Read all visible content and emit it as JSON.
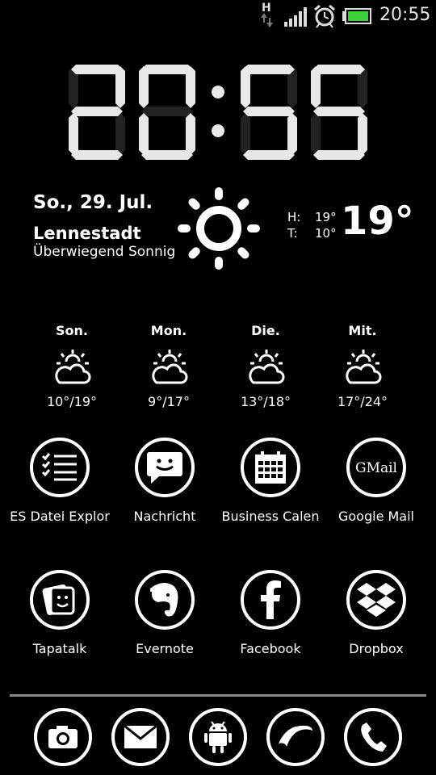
{
  "status_bar": {
    "network_type": "H",
    "time": "20:55",
    "icons": [
      "data-arrows-icon",
      "signal-icon",
      "alarm-icon",
      "battery-icon"
    ]
  },
  "clock": {
    "time": "20:55",
    "hours": "20",
    "minutes": "55"
  },
  "weather": {
    "date": "So., 29. Jul.",
    "city": "Lennestadt",
    "condition": "Überwiegend Sonnig",
    "high_label": "H:",
    "high": "19°",
    "low_label": "T:",
    "low": "10°",
    "current": "19°",
    "icon": "sun-icon",
    "forecast": [
      {
        "day": "Son.",
        "temps": "10°/19°",
        "icon": "partly-cloudy-icon"
      },
      {
        "day": "Mon.",
        "temps": "9°/17°",
        "icon": "partly-cloudy-icon"
      },
      {
        "day": "Die.",
        "temps": "13°/18°",
        "icon": "partly-cloudy-icon"
      },
      {
        "day": "Mit.",
        "temps": "17°/24°",
        "icon": "partly-cloudy-icon"
      }
    ]
  },
  "apps_row1": [
    {
      "label": "ES Datei Explor",
      "icon": "list-icon"
    },
    {
      "label": "Nachricht",
      "icon": "message-icon"
    },
    {
      "label": "Business Calen",
      "icon": "calendar-icon"
    },
    {
      "label": "Google Mail",
      "icon": "gmail-icon"
    }
  ],
  "apps_row2": [
    {
      "label": "Tapatalk",
      "icon": "tapatalk-icon"
    },
    {
      "label": "Evernote",
      "icon": "evernote-icon"
    },
    {
      "label": "Facebook",
      "icon": "facebook-icon"
    },
    {
      "label": "Dropbox",
      "icon": "dropbox-icon"
    }
  ],
  "dock": [
    "camera-icon",
    "mail-icon",
    "android-icon",
    "dolphin-icon",
    "phone-icon"
  ]
}
